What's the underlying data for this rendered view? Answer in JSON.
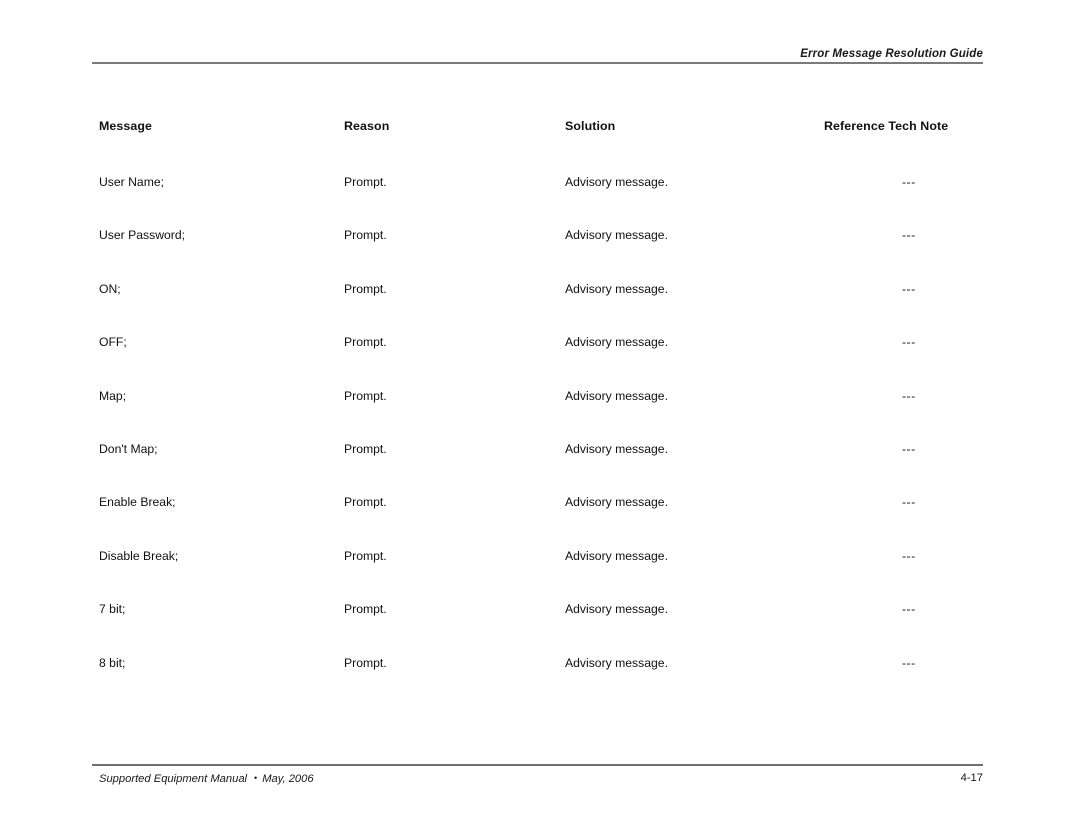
{
  "header": {
    "title": "Error Message Resolution Guide"
  },
  "table": {
    "columns": [
      {
        "key": "message",
        "label": "Message"
      },
      {
        "key": "reason",
        "label": "Reason"
      },
      {
        "key": "solution",
        "label": "Solution"
      },
      {
        "key": "reference",
        "label": "Reference Tech Note"
      }
    ],
    "rows": [
      {
        "message": "User Name;",
        "reason": "Prompt.",
        "solution": "Advisory message.",
        "reference": "---"
      },
      {
        "message": "User Password;",
        "reason": "Prompt.",
        "solution": "Advisory message.",
        "reference": "---"
      },
      {
        "message": "ON;",
        "reason": "Prompt.",
        "solution": "Advisory message.",
        "reference": "---"
      },
      {
        "message": "OFF;",
        "reason": "Prompt.",
        "solution": "Advisory message.",
        "reference": "---"
      },
      {
        "message": "Map;",
        "reason": "Prompt.",
        "solution": "Advisory message.",
        "reference": "---"
      },
      {
        "message": "Don't Map;",
        "reason": "Prompt.",
        "solution": "Advisory message.",
        "reference": "---"
      },
      {
        "message": "Enable Break;",
        "reason": "Prompt.",
        "solution": "Advisory message.",
        "reference": "---"
      },
      {
        "message": "Disable Break;",
        "reason": "Prompt.",
        "solution": "Advisory message.",
        "reference": "---"
      },
      {
        "message": "7 bit;",
        "reason": "Prompt.",
        "solution": "Advisory message.",
        "reference": "---"
      },
      {
        "message": "8 bit;",
        "reason": "Prompt.",
        "solution": "Advisory message.",
        "reference": "---"
      }
    ]
  },
  "footer": {
    "manual_title": "Supported Equipment Manual",
    "separator": "•",
    "date": "May, 2006",
    "page_number": "4-17"
  }
}
